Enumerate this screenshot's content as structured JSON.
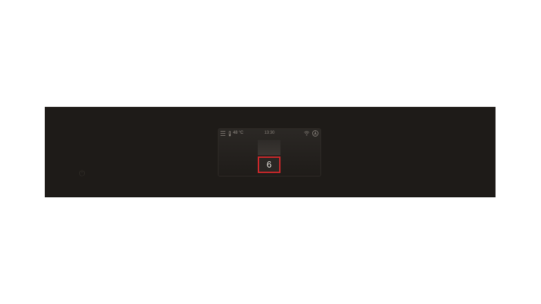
{
  "display": {
    "temperature": "48 °C",
    "clock": "13:30",
    "selector": {
      "selected_value": "6"
    }
  },
  "icons": {
    "menu": "menu-icon",
    "thermometer": "thermometer-icon",
    "wifi": "wifi-icon",
    "brand": "brand-logo-icon",
    "power": "power-icon"
  },
  "colors": {
    "panel": "#1e1b18",
    "screen": "#24211e",
    "selection_border": "#d1282b",
    "text_primary": "#e9e5df",
    "text_secondary": "#9a948c"
  }
}
